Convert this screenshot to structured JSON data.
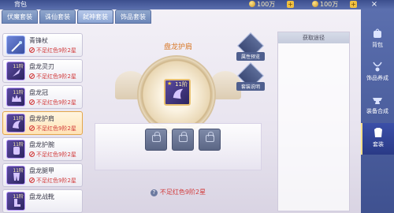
{
  "window": {
    "title": "背包"
  },
  "resources": [
    {
      "value": "100万"
    },
    {
      "value": "100万"
    }
  ],
  "tabs": [
    {
      "label": "伏魔套装",
      "active": false
    },
    {
      "label": "诛仙套装",
      "active": false
    },
    {
      "label": "弑神套装",
      "active": true
    },
    {
      "label": "饰品套装",
      "active": false
    }
  ],
  "items": [
    {
      "name": "青锋杖",
      "tier": "",
      "warning": "不足红色9阶2星",
      "selected": false
    },
    {
      "name": "盘龙灵刃",
      "tier": "11阶",
      "warning": "不足红色9阶2星",
      "selected": false
    },
    {
      "name": "盘龙冠",
      "tier": "11阶",
      "warning": "不足红色9阶2星",
      "selected": false
    },
    {
      "name": "盘龙护肩",
      "tier": "11阶",
      "warning": "不足红色9阶2星",
      "selected": true
    },
    {
      "name": "盘龙护腕",
      "tier": "11阶",
      "warning": "不足红色9阶2星",
      "selected": false
    },
    {
      "name": "盘龙腿甲",
      "tier": "11阶",
      "warning": "不足红色9阶2星",
      "selected": false
    },
    {
      "name": "盘龙战靴",
      "tier": "11阶",
      "warning": "",
      "selected": false
    }
  ],
  "detail": {
    "item_name": "盘龙护肩",
    "tier": "11阶",
    "bottom_warning": "不足红色9阶2星"
  },
  "actions": [
    {
      "label": "属性预览"
    },
    {
      "label": "套装说明"
    }
  ],
  "right_panel": {
    "header": "获取途径"
  },
  "nav": [
    {
      "label": "背包",
      "active": false
    },
    {
      "label": "饰品养成",
      "active": false
    },
    {
      "label": "装备合成",
      "active": false
    },
    {
      "label": "套装",
      "active": true
    }
  ],
  "colors": {
    "accent_orange": "#d87a2a",
    "warning_red": "#d23a3a",
    "nav_blue": "#3f5190",
    "selected_bg": "#ffe3b5"
  }
}
